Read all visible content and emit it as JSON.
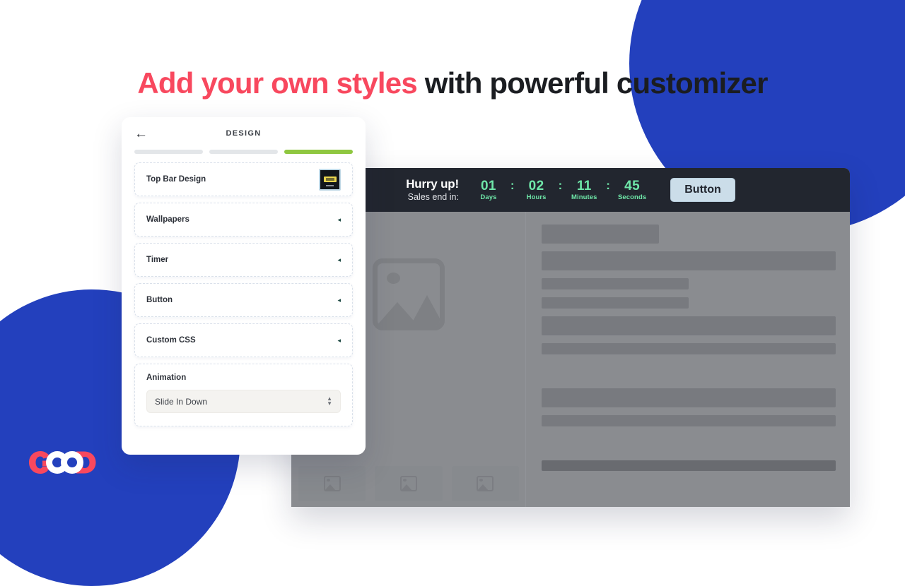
{
  "headline": {
    "accent_text": "Add your own styles",
    "rest_text": " with powerful customizer",
    "accent_color": "#F8485E",
    "text_color": "#1B1D21"
  },
  "brand": {
    "logo_text": "GOOD",
    "logo_red": "#F8485E",
    "logo_white": "#FFFFFF",
    "background_blue": "#2340BD"
  },
  "panel": {
    "back_icon": "arrow-left-icon",
    "title": "DESIGN",
    "progress": {
      "segments": 3,
      "active_index": 3,
      "active_color": "#8FC740",
      "inactive_color": "#E3E6E9"
    },
    "items": [
      {
        "label": "Top Bar Design",
        "type": "swatch",
        "chevron": ""
      },
      {
        "label": "Wallpapers",
        "type": "collapsed",
        "chevron": "◂"
      },
      {
        "label": "Timer",
        "type": "collapsed",
        "chevron": "◂"
      },
      {
        "label": "Button",
        "type": "collapsed",
        "chevron": "◂"
      },
      {
        "label": "Custom CSS",
        "type": "collapsed",
        "chevron": "◂"
      }
    ],
    "animation": {
      "label": "Animation",
      "selected": "Slide In Down",
      "stepper_up": "▲",
      "stepper_down": "▼"
    }
  },
  "preview": {
    "countdown": {
      "title": "Hurry up!",
      "subtitle": "Sales end in:",
      "separator": ":",
      "units": [
        {
          "value": "01",
          "label": "Days"
        },
        {
          "value": "02",
          "label": "Hours"
        },
        {
          "value": "11",
          "label": "Minutes"
        },
        {
          "value": "45",
          "label": "Seconds"
        }
      ],
      "button_label": "Button",
      "bar_background": "#22262F",
      "digit_color": "#6FE7A9",
      "button_background": "#CBDDE9"
    },
    "placeholder_icon": "image-placeholder-icon",
    "thumbnail_icon": "image-thumbnail-icon",
    "thumbnails_count": 3,
    "skeleton_rows": [
      {
        "width": "40%",
        "height": "tall"
      },
      {
        "width": "100%",
        "height": "tall"
      },
      {
        "width": "50%",
        "height": "normal"
      },
      {
        "width": "50%",
        "height": "normal"
      },
      {
        "width": "100%",
        "height": "tall"
      },
      {
        "width": "100%",
        "height": "normal"
      },
      {
        "width": "100%",
        "height": "tall"
      },
      {
        "width": "100%",
        "height": "normal"
      },
      {
        "width": "100%",
        "height": "dark"
      }
    ]
  }
}
